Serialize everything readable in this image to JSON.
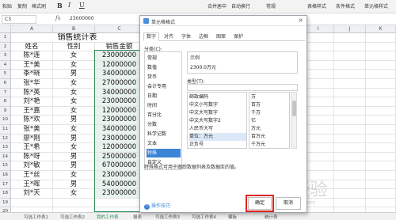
{
  "ribbon": {
    "items": [
      "粘贴",
      "复制",
      "格式刷",
      "B",
      "I",
      "U",
      "合并居中",
      "自动换行",
      "常规",
      "表格样式",
      "条件格式",
      "单元格样式"
    ]
  },
  "formula_bar": {
    "cell_ref": "C3",
    "fx": "fx",
    "value": "23000000"
  },
  "sheet": {
    "columns": [
      "A",
      "B",
      "C",
      "D",
      "E",
      "F",
      "G",
      "H",
      "I",
      "J",
      "K",
      "L",
      "M"
    ],
    "rows": [
      "1",
      "2",
      "3",
      "4",
      "5",
      "6",
      "7",
      "8",
      "9",
      "10",
      "11",
      "12",
      "13",
      "14",
      "15",
      "16",
      "17",
      "18",
      "19",
      "20",
      "21"
    ],
    "title": "销售统计表",
    "headers": [
      "姓名",
      "性别",
      "销售金额"
    ],
    "data": [
      [
        "陈*连",
        "女",
        "23000000"
      ],
      [
        "王*美",
        "女",
        "12000000"
      ],
      [
        "季*晓",
        "男",
        "34000000"
      ],
      [
        "张*华",
        "女",
        "27000000"
      ],
      [
        "陈*英",
        "女",
        "34000000"
      ],
      [
        "刘*艳",
        "女",
        "23000000"
      ],
      [
        "王*嘉",
        "女",
        "12000000"
      ],
      [
        "陈*欢",
        "男",
        "23000000"
      ],
      [
        "张*美",
        "女",
        "34000000"
      ],
      [
        "廖*刚",
        "男",
        "23000000"
      ],
      [
        "王*希",
        "女",
        "12000000"
      ],
      [
        "陈*呀",
        "男",
        "25000000"
      ],
      [
        "刘*敏",
        "男",
        "67000000"
      ],
      [
        "王*丝",
        "女",
        "23000000"
      ],
      [
        "王*晖",
        "男",
        "54000000"
      ],
      [
        "刘*天",
        "女",
        "23000000"
      ]
    ],
    "sheet_tabs": [
      "可选工作表1",
      "可选工作表2",
      "我的工作表",
      "报表",
      "可选工作表3",
      "可选工作表4",
      "模板",
      "统计表"
    ]
  },
  "dialog": {
    "title": "单元格格式",
    "close": "×",
    "tabs": [
      "数字",
      "对齐",
      "字体",
      "边框",
      "图案",
      "保护"
    ],
    "active_tab": "数字",
    "category_label": "分类(C):",
    "categories": [
      "常规",
      "数值",
      "货币",
      "会计专用",
      "日期",
      "时间",
      "百分比",
      "分数",
      "科学记数",
      "文本",
      "特殊",
      "自定义"
    ],
    "selected_category": "特殊",
    "sample_label": "示例",
    "sample_value": "2300.0万元",
    "type_label": "类型(T):",
    "types_left": [
      "邮政编码",
      "中文小写数字",
      "中文大写数字",
      "中文大写数字2",
      "人民币大写",
      "单位：万元",
      "正负号"
    ],
    "selected_type": "单位：万元",
    "types_right": [
      "万",
      "百万",
      "千万",
      "亿",
      "万元",
      "百万元",
      "千万元"
    ],
    "description": "特殊格式可用于跟踪数据列表及数据库的值。",
    "tips": "操作技巧",
    "ok": "确定",
    "cancel": "取消"
  },
  "watermark": {
    "text": "Baidu 经验",
    "sub": "jingyan.baidu.com"
  }
}
